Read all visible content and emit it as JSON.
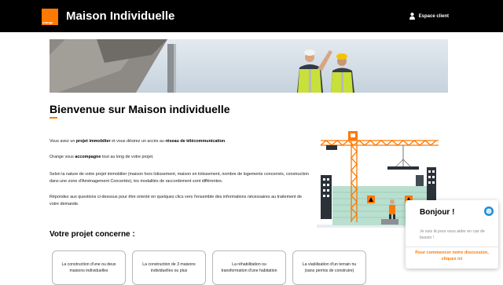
{
  "header": {
    "brand": "orange",
    "title": "Maison Individuelle",
    "account_label": "Espace client",
    "account_icon": "user-icon",
    "accent_color": "#ff7900",
    "background_color": "#000000"
  },
  "hero": {
    "image": "construction-workers-photo"
  },
  "main": {
    "title": "Bienvenue sur Maison individuelle",
    "paragraphs": [
      {
        "before": "Vous avez un ",
        "bold1": "projet immobilier",
        "middle": " et vous désirez un accès au ",
        "bold2": "réseau de télécommunication",
        "after": "."
      },
      {
        "before": "Orange vous ",
        "bold1": "accompagne",
        "after": " tout au long de votre projet."
      },
      {
        "text": "Selon la nature de votre projet immobilier (maison hors lotissement, maison en lotissement, nombre de logements concernés, construction dans une zone d'Aménagement Concertée), les modalités de raccordement sont différentes."
      },
      {
        "text": "Répondez aux questions ci-dessous pour être orienté en quelques clics vers l'ensemble des informations nécessaires au traitement de votre demande."
      }
    ],
    "section_title": "Votre projet concerne :",
    "options": [
      "La construction d'une ou deux maisons individuelles",
      "La construction de 3 maisons individuelles ou plus",
      "La réhabilitation ou transformation d'une habitation",
      "La viabilisation d'un terrain nu (sans permis de construire)"
    ]
  },
  "chat": {
    "title": "Bonjour !",
    "message": "Je suis là pour vous aider en cas de besoin !",
    "cta": "Pour commencer notre discussion, cliquez ici",
    "avatar_icon": "bot-avatar-icon"
  }
}
